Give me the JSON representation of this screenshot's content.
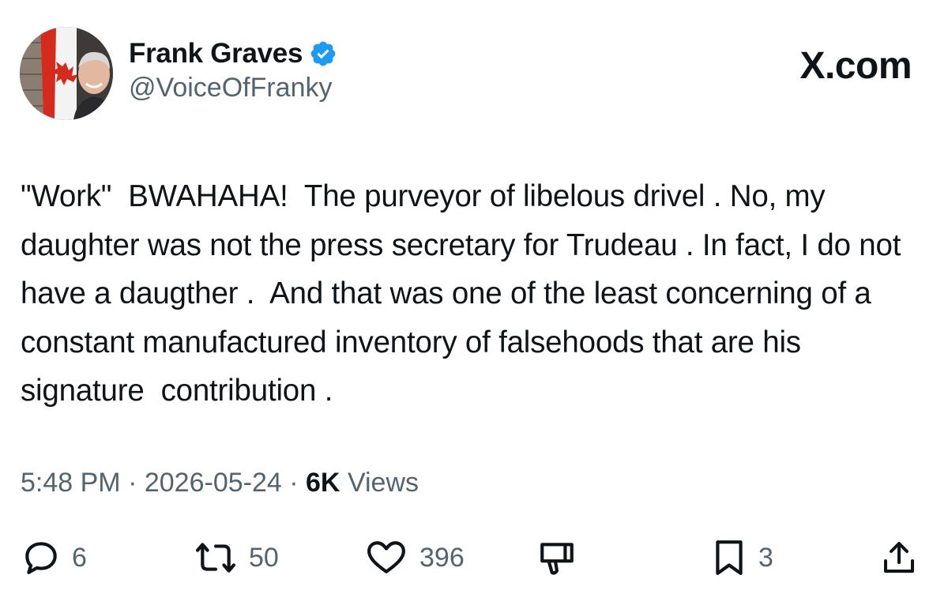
{
  "author": {
    "display_name": "Frank Graves",
    "handle": "@VoiceOfFranky",
    "verified": true,
    "avatar_icon": "avatar-with-canadian-flag"
  },
  "brand": {
    "label": "X.com"
  },
  "tweet": {
    "text": "\"Work\"  BWAHAHA!  The purveyor of libelous drivel . No, my daughter was not the press secretary for Trudeau . In fact, I do not have a daugther .  And that was one of the least concerning of a constant manufactured inventory of falsehoods that are his signature  contribution ."
  },
  "meta": {
    "time": "5:48 PM",
    "separator": "·",
    "date": "2026-05-24",
    "views_count": "6K",
    "views_label": "Views"
  },
  "actions": {
    "replies": "6",
    "reposts": "50",
    "likes": "396",
    "bookmarks": "3"
  },
  "colors": {
    "text_primary": "#0f1419",
    "text_secondary": "#536471",
    "verified_blue": "#1d9bf0",
    "flag_red": "#d52b1e"
  }
}
